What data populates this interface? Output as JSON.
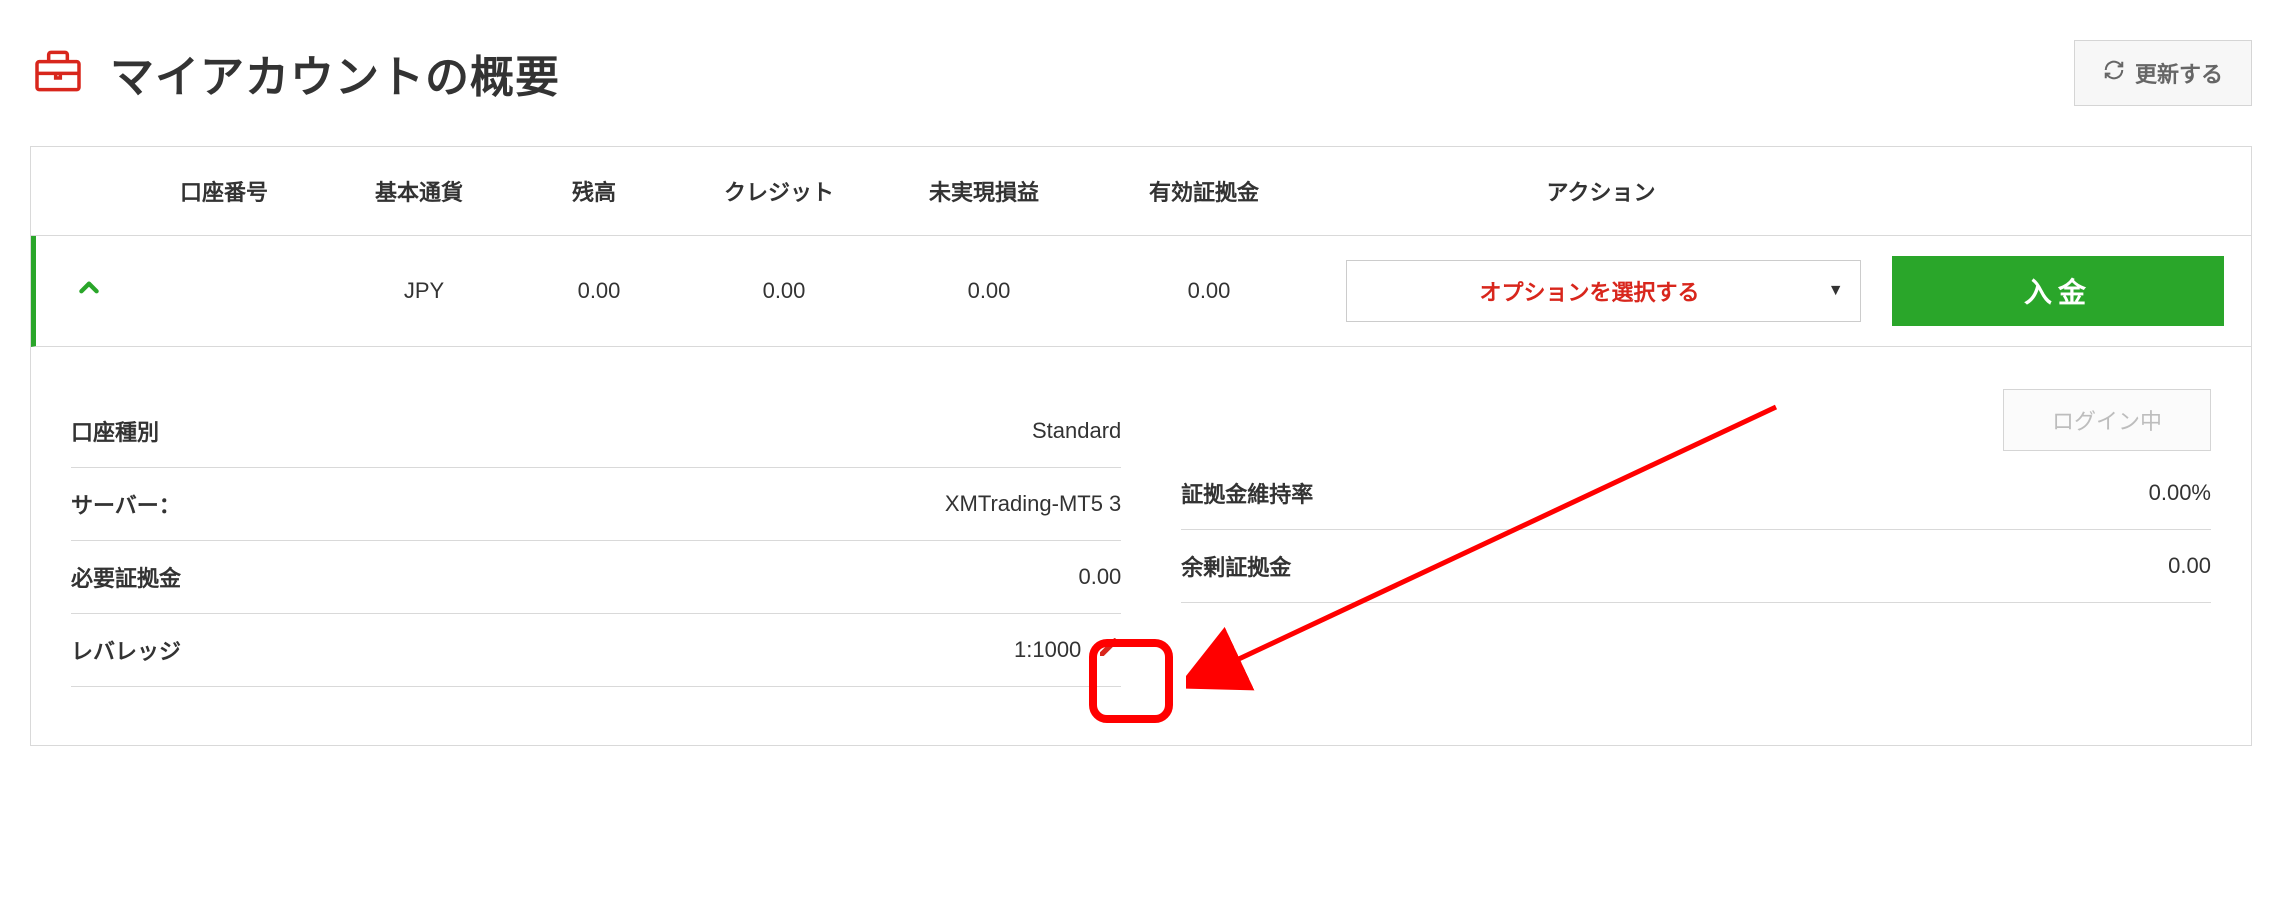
{
  "header": {
    "title": "マイアカウントの概要",
    "refresh_label": "更新する"
  },
  "table": {
    "headers": {
      "account": "口座番号",
      "currency": "基本通貨",
      "balance": "残高",
      "credit": "クレジット",
      "unrealized": "未実現損益",
      "equity": "有効証拠金",
      "action": "アクション"
    },
    "row": {
      "currency": "JPY",
      "balance": "0.00",
      "credit": "0.00",
      "unrealized": "0.00",
      "equity": "0.00",
      "action_label": "オプションを選択する",
      "deposit_label": "入金"
    }
  },
  "details": {
    "left": {
      "account_type_label": "口座種別",
      "account_type_value": "Standard",
      "server_label": "サーバー：",
      "server_value": "XMTrading-MT5 3",
      "margin_req_label": "必要証拠金",
      "margin_req_value": "0.00",
      "leverage_label": "レバレッジ",
      "leverage_value": "1:1000"
    },
    "right": {
      "login_label": "ログイン中",
      "margin_level_label": "証拠金維持率",
      "margin_level_value": "0.00%",
      "free_margin_label": "余剰証拠金",
      "free_margin_value": "0.00"
    }
  }
}
